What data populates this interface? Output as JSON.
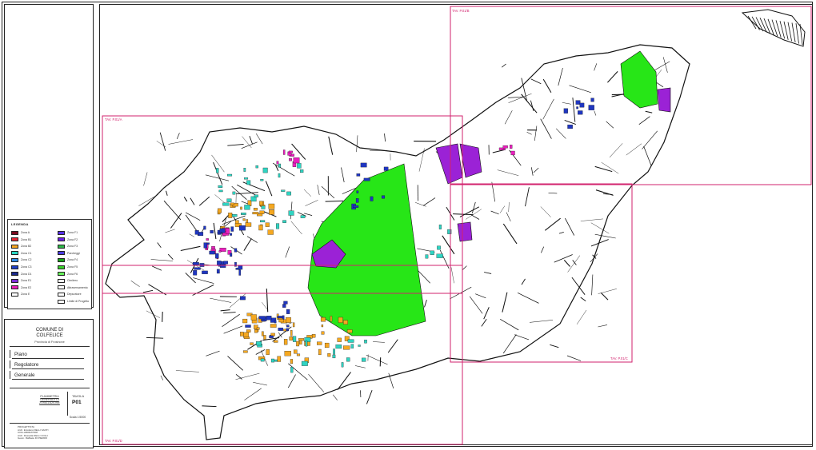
{
  "legend": {
    "title": "LEGENDA",
    "items": [
      {
        "label": "Zona A",
        "color": "#7a0b1f",
        "col": 0,
        "row": 0
      },
      {
        "label": "Zona B1",
        "color": "#e52636",
        "col": 0,
        "row": 1
      },
      {
        "label": "Zona B2",
        "color": "#f7a623",
        "col": 0,
        "row": 2
      },
      {
        "label": "Zona C1",
        "color": "#2bd8c4",
        "col": 0,
        "row": 3
      },
      {
        "label": "Zona C2",
        "color": "#2f8ee9",
        "col": 0,
        "row": 4
      },
      {
        "label": "Zona C3",
        "color": "#1e3fc7",
        "col": 0,
        "row": 5
      },
      {
        "label": "Zona D1",
        "color": "#1a2a8c",
        "col": 0,
        "row": 6
      },
      {
        "label": "Zona E1",
        "color": "#7a2fd6",
        "col": 0,
        "row": 7
      },
      {
        "label": "Zona E2",
        "color": "#e81fb8",
        "col": 0,
        "row": 8
      },
      {
        "label": "Zona E",
        "color": "#ffffff",
        "col": 0,
        "row": 9
      },
      {
        "label": "Zona F1",
        "color": "#5630e6",
        "col": 1,
        "row": 0
      },
      {
        "label": "Zona F2",
        "color": "#6d1ee8",
        "col": 1,
        "row": 1
      },
      {
        "label": "Zona F3",
        "color": "#2fb84a",
        "col": 1,
        "row": 2
      },
      {
        "label": "Parcheggi",
        "color": "#4a3ae0",
        "col": 1,
        "row": 3
      },
      {
        "label": "Zona F4",
        "color": "#18a318",
        "col": 1,
        "row": 4
      },
      {
        "label": "Zona F5",
        "color": "#39d12a",
        "col": 1,
        "row": 5
      },
      {
        "label": "Zona F6",
        "color": "#66f05a",
        "col": 1,
        "row": 6
      },
      {
        "label": "Cimitero",
        "color": "#ffffff",
        "col": 1,
        "row": 7
      },
      {
        "label": "Attraversamento",
        "color": "#ffffff",
        "col": 1,
        "row": 8
      },
      {
        "label": "Depuratore",
        "color": "#ffffff",
        "col": 1,
        "row": 9
      },
      {
        "label": "Limite di Progetto",
        "color": "#ffffff",
        "col": 1,
        "row": 10
      }
    ]
  },
  "title_block": {
    "comune": "COMUNE DI",
    "name": "COLFELICE",
    "provincia": "Provincia di Frosinone",
    "plan_words": [
      "Piano",
      "Regolatore",
      "Generale"
    ],
    "subject": "PLANIMETRIA GENERALE DI ZONIZZAZIONE",
    "tavola_label": "TAVOLA",
    "tavola_number": "P01",
    "scale": "Scala 1:5000",
    "credits": "PROGETTISTA\nArch. Ercolano DELLI SANTI\nCOLLABORATORI\nArch. Rossella DELLI COLLI\nGeom. Raffaele DI PIERRO"
  },
  "sheets": [
    {
      "label": "TAV. P.01/A"
    },
    {
      "label": "TAV. P.01/B"
    },
    {
      "label": "TAV. P.01/C"
    },
    {
      "label": "TAV. P.01/D"
    }
  ],
  "colors": {
    "sheet_border": "#d2226d",
    "parcel_line": "#111111",
    "green_zone": "#27e617",
    "purple_zone": "#9b22d6",
    "magenta_zone": "#ea1fbe",
    "orange_zone": "#f5a820",
    "cyan_zone": "#2fd4c2",
    "blue_zone": "#1f36c0"
  }
}
